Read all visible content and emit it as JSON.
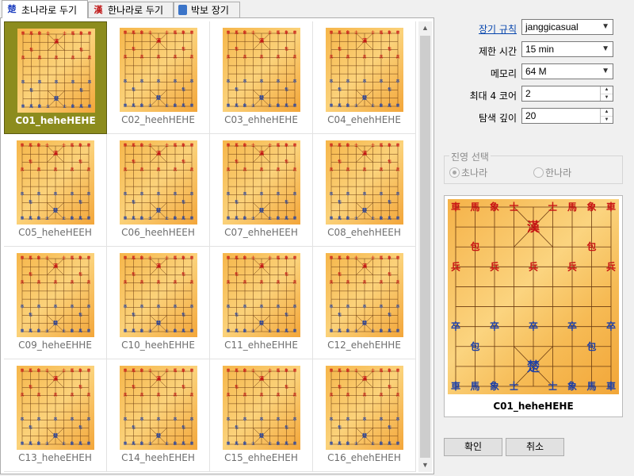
{
  "tabs": [
    {
      "label": "초나라로 두기",
      "icon": "cho-piece-icon"
    },
    {
      "label": "한나라로 두기",
      "icon": "han-piece-icon"
    },
    {
      "label": "박보 장기",
      "icon": "book-icon"
    }
  ],
  "boards": [
    "C01_heheHEHE",
    "C02_heehHEHE",
    "C03_ehheHEHE",
    "C04_ehehHEHE",
    "C05_heheHEEH",
    "C06_heehHEEH",
    "C07_ehheHEEH",
    "C08_ehehHEEH",
    "C09_heheEHHE",
    "C10_heehEHHE",
    "C11_ehheEHHE",
    "C12_ehehEHHE",
    "C13_heheEHEH",
    "C14_heehEHEH",
    "C15_ehheEHEH",
    "C16_ehehEHEH"
  ],
  "selected_board": "C01_heheHEHE",
  "settings": {
    "rule_label": "장기 규칙",
    "rule_value": "janggicasual",
    "time_label": "제한 시간",
    "time_value": "15 min",
    "memory_label": "메모리",
    "memory_value": "64 M",
    "cores_label": "최대 4 코어",
    "cores_value": "2",
    "depth_label": "탐색 깊이",
    "depth_value": "20"
  },
  "side": {
    "group_label": "진영 선택",
    "cho_label": "초나라",
    "han_label": "한나라",
    "selected": "cho"
  },
  "preview": {
    "label": "C01_heheHEHE",
    "han_pieces": [
      "車",
      "馬",
      "象",
      "士",
      "漢",
      "士",
      "馬",
      "象",
      "車",
      "包",
      "包",
      "兵",
      "兵",
      "兵",
      "兵",
      "兵"
    ],
    "cho_pieces": [
      "車",
      "馬",
      "象",
      "士",
      "楚",
      "士",
      "象",
      "馬",
      "車",
      "包",
      "包",
      "卒",
      "卒",
      "卒",
      "卒",
      "卒"
    ]
  },
  "buttons": {
    "ok": "확인",
    "cancel": "취소"
  },
  "colors": {
    "red_piece": "#c81414",
    "blue_piece": "#1c3fa8",
    "board": "#f7c062",
    "selection": "#8c8c1e"
  }
}
